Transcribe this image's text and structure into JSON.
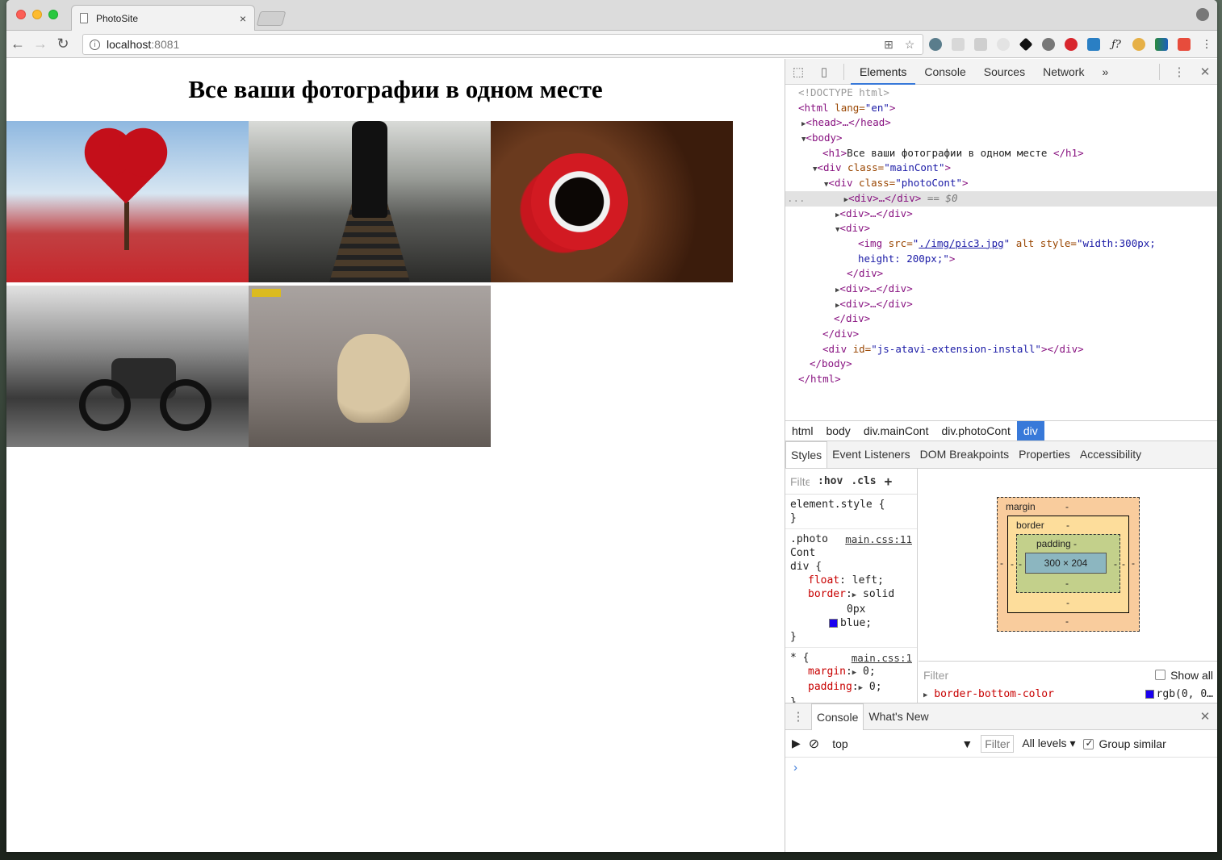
{
  "browser": {
    "tab_title": "PhotoSite",
    "tab_close": "×",
    "url_host": "localhost",
    "url_port": ":8081"
  },
  "page": {
    "heading": "Все ваши фотографии в одном месте",
    "photos": [
      {
        "name": "heart-tree"
      },
      {
        "name": "railway-walker"
      },
      {
        "name": "coffee-cup"
      },
      {
        "name": "motorcycle"
      },
      {
        "name": "cheetah"
      }
    ]
  },
  "devtools": {
    "tabs": [
      "Elements",
      "Console",
      "Sources",
      "Network"
    ],
    "more": "»",
    "elements": {
      "doctype": "<!DOCTYPE html>",
      "html_open": "<html",
      "html_attr": " lang=",
      "html_val": "\"en\"",
      "head": "<head>…</head>",
      "body_open": "<body>",
      "h1_open": "<h1>",
      "h1_text": "Все ваши фотографии в одном месте ",
      "h1_close": "</h1>",
      "div_open": "<div",
      "class_attr": " class=",
      "mainCont": "\"mainCont\"",
      "photoCont": "\"photoCont\"",
      "gt": ">",
      "div_collapsed": "<div>…</div>",
      "sel_suffix": " == $0",
      "div_plain": "<div>",
      "img_open": "<img",
      "src_attr": " src=",
      "src_val": "./img/pic3.jpg",
      "alt_attr": " alt",
      "style_attr": " style=",
      "style_val1": "\"width:300px;",
      "style_val2": "height: 200px;\"",
      "div_close": "</div>",
      "id_attr": " id=",
      "atavi": "\"js-atavi-extension-install\"",
      "atavi_close": "></div>",
      "body_close": "</body>",
      "html_close": "</html>",
      "ellipsis": "..."
    },
    "breadcrumbs": [
      "html",
      "body",
      "div.mainCont",
      "div.photoCont",
      "div"
    ],
    "subtabs": [
      "Styles",
      "Event Listeners",
      "DOM Breakpoints",
      "Properties",
      "Accessibility"
    ],
    "styles": {
      "filter_placeholder": "Filter",
      "hov": ":hov",
      "cls": ".cls",
      "plus": "+",
      "element_style": "element.style {",
      "close_brace": "}",
      "rule1_selector1": ".photo",
      "rule1_selector2": "Cont",
      "rule1_selector3": "div {",
      "rule1_source": "main.css:11",
      "float_prop": "float",
      "float_val": " left;",
      "border_prop": "border",
      "border_val1": " solid",
      "border_val2": "0px",
      "border_val3": "blue;",
      "rule2_selector": "* {",
      "rule2_source": "main.css:1",
      "margin_prop": "margin",
      "margin_val": " 0;",
      "padding_prop": "padding",
      "padding_val": " 0;"
    },
    "box_model": {
      "margin_label": "margin",
      "border_label": "border",
      "padding_label": "padding -",
      "content": "300 × 204",
      "dash": "-"
    },
    "computed": {
      "filter_placeholder": "Filter",
      "show_all": "Show all",
      "row_prop": "border-bottom-color",
      "row_val": "rgb(0, 0…"
    },
    "drawer": {
      "tabs": [
        "Console",
        "What's New"
      ],
      "context": "top",
      "filter": "Filter",
      "levels": "All levels ▾",
      "group_similar": "Group similar",
      "prompt": "›"
    }
  },
  "colors": {
    "accent": "#3879d9",
    "swatch_blue": "#1a00f0"
  }
}
